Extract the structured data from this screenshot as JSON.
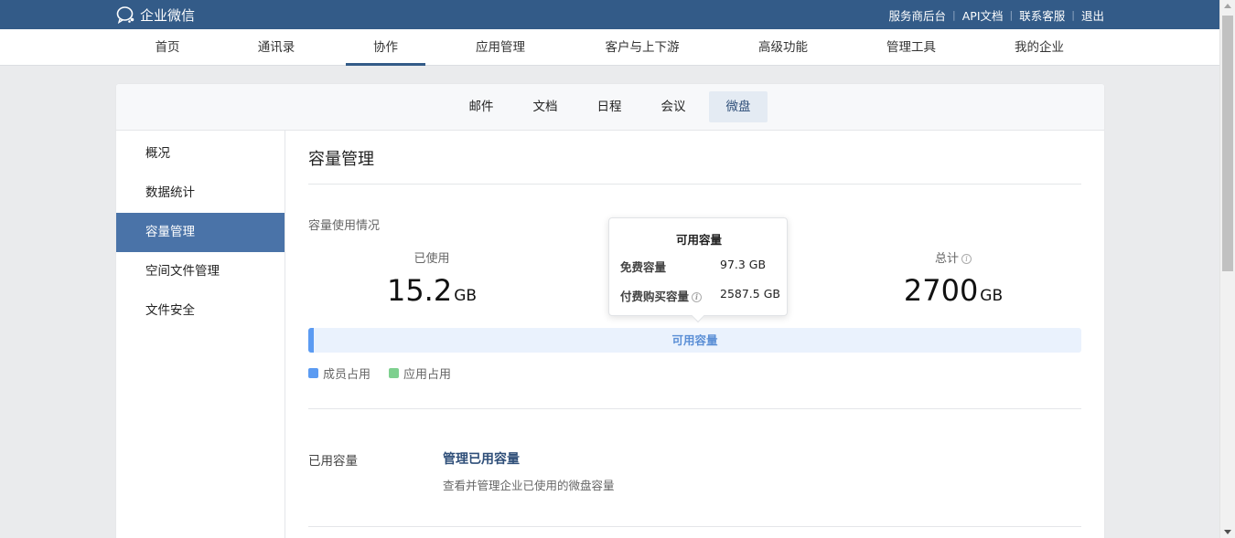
{
  "header": {
    "logo_text": "企业微信",
    "links": [
      "服务商后台",
      "API文档",
      "联系客服",
      "退出"
    ]
  },
  "main_nav": {
    "items": [
      "首页",
      "通讯录",
      "协作",
      "应用管理",
      "客户与上下游",
      "高级功能",
      "管理工具",
      "我的企业"
    ],
    "active": "协作"
  },
  "sub_nav": {
    "items": [
      "邮件",
      "文档",
      "日程",
      "会议",
      "微盘"
    ],
    "active": "微盘"
  },
  "sidebar": {
    "items": [
      "概况",
      "数据统计",
      "容量管理",
      "空间文件管理",
      "文件安全"
    ],
    "active": "容量管理"
  },
  "content": {
    "title": "容量管理",
    "usage_label": "容量使用情况",
    "used": {
      "label": "已使用",
      "value": "15.2",
      "unit": "GB"
    },
    "total": {
      "label": "总计",
      "value": "2700",
      "unit": "GB"
    },
    "bar": {
      "text": "可用容量",
      "used_fraction": 0.0056,
      "fill_color": "#5b9bf2"
    },
    "legend": [
      {
        "label": "成员占用",
        "color": "#5b9bf2"
      },
      {
        "label": "应用占用",
        "color": "#7ed08f"
      }
    ],
    "used_row": {
      "label": "已用容量",
      "link": "管理已用容量",
      "desc": "查看并管理企业已使用的微盘容量"
    }
  },
  "tooltip": {
    "title": "可用容量",
    "rows": [
      {
        "key": "免费容量",
        "value": "97.3 GB"
      },
      {
        "key": "付费购买容量",
        "value": "2587.5 GB"
      }
    ]
  },
  "colors": {
    "header_bg": "#335b88",
    "active_side": "#4a73a8"
  }
}
